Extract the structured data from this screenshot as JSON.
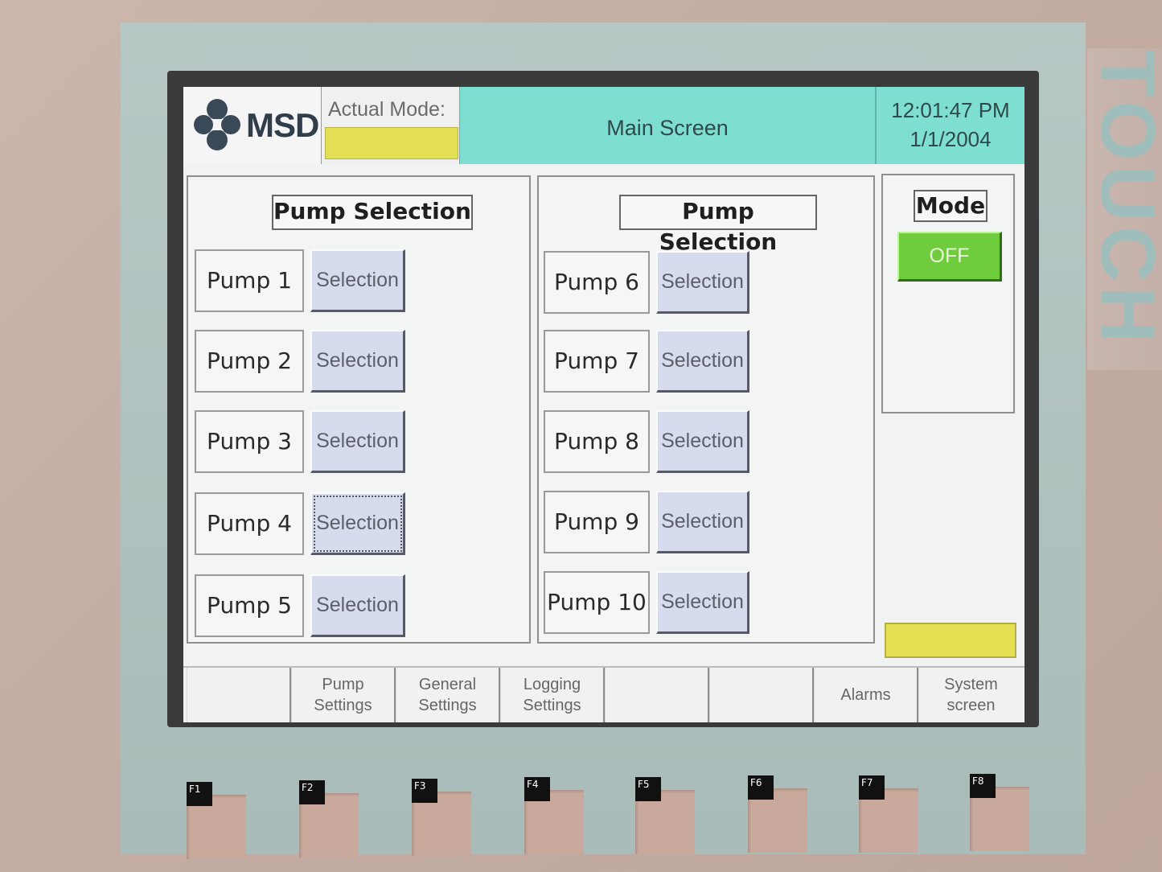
{
  "brand": {
    "vertical_text": "TOUCH"
  },
  "header": {
    "logo_text": "MSD",
    "actual_mode_label": "Actual Mode:",
    "actual_mode_value": "",
    "title": "Main Screen",
    "time": "12:01:47 PM",
    "date": "1/1/2004"
  },
  "left_panel": {
    "title": "Pump Selection",
    "pumps": [
      {
        "label": "Pump 1",
        "button": "Selection"
      },
      {
        "label": "Pump 2",
        "button": "Selection"
      },
      {
        "label": "Pump 3",
        "button": "Selection"
      },
      {
        "label": "Pump 4",
        "button": "Selection"
      },
      {
        "label": "Pump 5",
        "button": "Selection"
      }
    ]
  },
  "right_panel": {
    "title": "Pump Selection",
    "pumps": [
      {
        "label": "Pump 6",
        "button": "Selection"
      },
      {
        "label": "Pump 7",
        "button": "Selection"
      },
      {
        "label": "Pump 8",
        "button": "Selection"
      },
      {
        "label": "Pump 9",
        "button": "Selection"
      },
      {
        "label": "Pump 10",
        "button": "Selection"
      }
    ]
  },
  "mode_panel": {
    "title": "Mode",
    "button": "OFF"
  },
  "footer": {
    "keys": [
      "",
      "Pump\nSettings",
      "General\nSettings",
      "Logging\nSettings",
      "",
      "",
      "Alarms",
      "System\nscreen"
    ]
  },
  "hardware_keys": [
    "F1",
    "F2",
    "F3",
    "F4",
    "F5",
    "F6",
    "F7",
    "F8"
  ],
  "colors": {
    "header_accent": "#7fded2",
    "selection_button": "#d6dced",
    "mode_off": "#6fcc3c",
    "status_yellow": "#e4df53"
  }
}
